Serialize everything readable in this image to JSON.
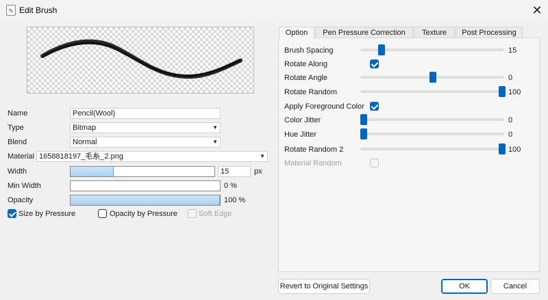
{
  "window": {
    "title": "Edit Brush",
    "app_icon": "brush-app-icon",
    "close_glyph": "✕"
  },
  "left": {
    "name_label": "Name",
    "name_value": "Pencil(Wool)",
    "type_label": "Type",
    "type_value": "Bitmap",
    "blend_label": "Blend",
    "blend_value": "Normal",
    "material_label": "Material",
    "material_value": "1658818197_毛糸_2.png",
    "width_label": "Width",
    "width_value": "15",
    "width_unit": "px",
    "width_fraction": 0.3,
    "minwidth_label": "Min Width",
    "minwidth_value": "0 %",
    "minwidth_fraction": 0,
    "opacity_label": "Opacity",
    "opacity_value": "100 %",
    "opacity_fraction": 1,
    "size_by_pressure": {
      "label": "Size by Pressure",
      "checked": true
    },
    "opacity_by_pressure": {
      "label": "Opacity by Pressure",
      "checked": false
    },
    "soft_edge": {
      "label": "Soft Edge",
      "checked": false,
      "disabled": true
    }
  },
  "tabs": [
    {
      "label": "Option",
      "active": true
    },
    {
      "label": "Pen Pressure Correction",
      "active": false
    },
    {
      "label": "Texture",
      "active": false
    },
    {
      "label": "Post Processing",
      "active": false
    }
  ],
  "options": {
    "brush_spacing": {
      "label": "Brush Spacing",
      "value": "15"
    },
    "rotate_along": {
      "label": "Rotate Along",
      "checked": true
    },
    "rotate_angle": {
      "label": "Rotate Angle",
      "value": "0"
    },
    "rotate_random": {
      "label": "Rotate Random",
      "value": "100"
    },
    "apply_fg_color": {
      "label": "Apply Foreground Color",
      "checked": true
    },
    "color_jitter": {
      "label": "Color Jitter",
      "value": "0"
    },
    "hue_jitter": {
      "label": "Hue Jitter",
      "value": "0"
    },
    "rotate_random_2": {
      "label": "Rotate Random 2",
      "value": "100"
    },
    "material_random": {
      "label": "Material Random",
      "checked": false,
      "disabled": true
    }
  },
  "buttons": {
    "revert": "Revert to Original Settings",
    "ok": "OK",
    "cancel": "Cancel"
  },
  "colors": {
    "accent": "#0067c0",
    "bar_fill": "#a9d0f3",
    "window_bg": "#f0f0f0"
  }
}
